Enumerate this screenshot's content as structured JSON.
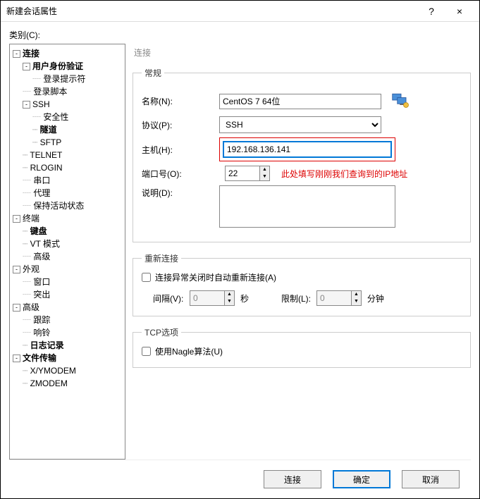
{
  "titlebar": {
    "title": "新建会话属性",
    "help": "?",
    "close": "×"
  },
  "category_label": "类别(C):",
  "tree": {
    "connection": "连接",
    "user_auth": "用户身份验证",
    "login_hint": "登录提示符",
    "login_script": "登录脚本",
    "ssh": "SSH",
    "security": "安全性",
    "tunnel": "隧道",
    "sftp": "SFTP",
    "telnet": "TELNET",
    "rlogin": "RLOGIN",
    "serial": "串口",
    "proxy": "代理",
    "keepalive": "保持活动状态",
    "terminal": "终端",
    "keyboard": "键盘",
    "vt": "VT 模式",
    "advanced_t": "高级",
    "appearance": "外观",
    "window": "窗口",
    "highlight": "突出",
    "advanced": "高级",
    "trace": "跟踪",
    "bell": "响铃",
    "logging": "日志记录",
    "file_transfer": "文件传输",
    "xymodem": "X/YMODEM",
    "zmodem": "ZMODEM"
  },
  "right_header": "连接",
  "general": {
    "legend": "常规",
    "name_label": "名称(N):",
    "name_value": "CentOS 7 64位",
    "protocol_label": "协议(P):",
    "protocol_value": "SSH",
    "host_label": "主机(H):",
    "host_value": "192.168.136.141",
    "port_label": "端口号(O):",
    "port_value": "22",
    "annotation": "此处填写刚刚我们查询到的IP地址",
    "desc_label": "说明(D):",
    "desc_value": ""
  },
  "reconnect": {
    "legend": "重新连接",
    "checkbox_label": "连接异常关闭时自动重新连接(A)",
    "checked": false,
    "interval_label": "间隔(V):",
    "interval_value": "0",
    "interval_unit": "秒",
    "limit_label": "限制(L):",
    "limit_value": "0",
    "limit_unit": "分钟"
  },
  "tcp": {
    "legend": "TCP选项",
    "nagle_label": "使用Nagle算法(U)",
    "nagle_checked": false
  },
  "buttons": {
    "connect": "连接",
    "ok": "确定",
    "cancel": "取消"
  }
}
